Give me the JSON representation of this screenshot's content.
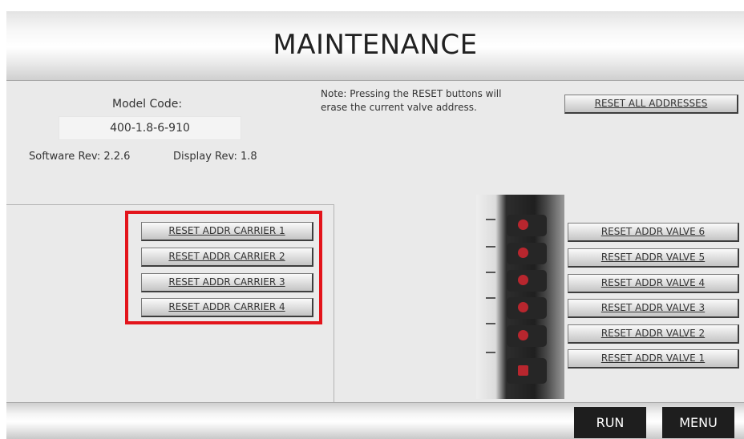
{
  "header": {
    "title": "MAINTENANCE"
  },
  "info": {
    "model_code_label": "Model Code:",
    "model_code_value": "400-1.8-6-910",
    "software_rev": "Software Rev:  2.2.6",
    "display_rev": "Display Rev: 1.8"
  },
  "note": {
    "line1": "Note: Pressing the RESET buttons will",
    "line2": "erase the current valve address."
  },
  "buttons": {
    "reset_all": "RESET ALL ADDRESSES",
    "carriers": [
      "RESET ADDR CARRIER 1",
      "RESET ADDR CARRIER 2",
      "RESET ADDR CARRIER 3",
      "RESET ADDR CARRIER 4"
    ],
    "valves": [
      "RESET ADDR VALVE 6",
      "RESET ADDR VALVE 5",
      "RESET ADDR VALVE 4",
      "RESET ADDR VALVE 3",
      "RESET ADDR VALVE 2",
      "RESET ADDR VALVE 1"
    ]
  },
  "footer": {
    "run": "RUN",
    "menu": "MENU"
  },
  "colors": {
    "highlight": "#e3141b",
    "nav_button": "#1e1e1e",
    "panel_bg": "#eaeaea"
  }
}
